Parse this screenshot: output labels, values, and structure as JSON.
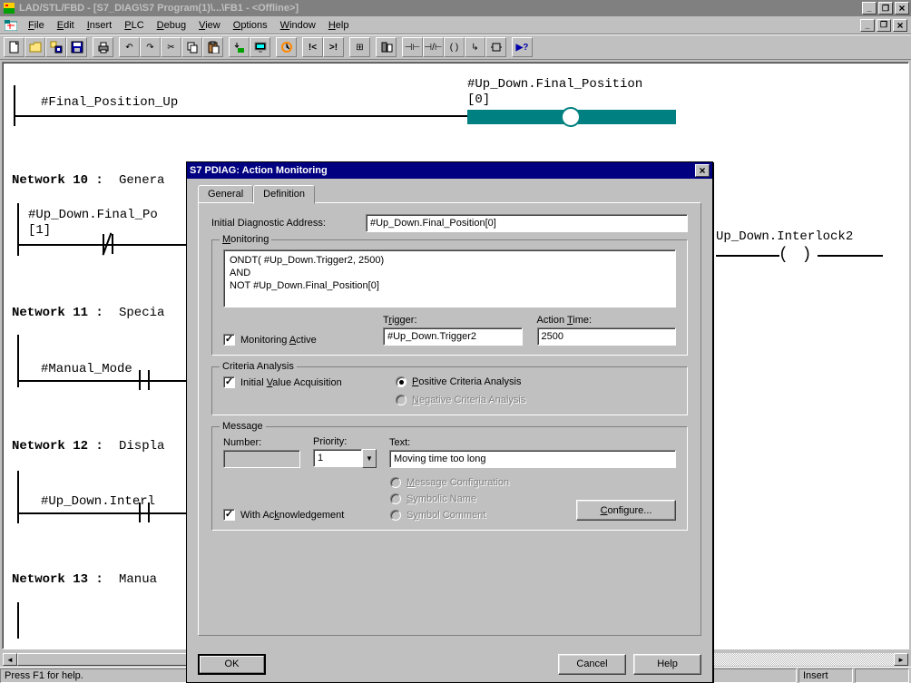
{
  "title": "LAD/STL/FBD  - [S7_DIAG\\S7 Program(1)\\...\\FB1 - <Offline>]",
  "menu": [
    "File",
    "Edit",
    "Insert",
    "PLC",
    "Debug",
    "View",
    "Options",
    "Window",
    "Help"
  ],
  "toolbar_icons": [
    "new",
    "open",
    "save-multi",
    "save",
    "",
    "print",
    "",
    "undo",
    "redo",
    "cut",
    "copy",
    "paste",
    "",
    "download",
    "monitor",
    "",
    "var-table",
    "",
    "goto-start",
    "goto-end",
    "",
    "sym-info",
    "",
    "library",
    "",
    "block1",
    "block2",
    "parens",
    "arrow",
    "ll-icon",
    "",
    "context-help"
  ],
  "editor": {
    "label1": "#Final_Position_Up",
    "label2_line1": "#Up_Down.Final_Position",
    "label2_line2": "[0]",
    "network10": "Network 10 :",
    "network10_title": "Genera",
    "net10_label": "#Up_Down.Final_Po",
    "net10_label2": "[1]",
    "net10_right": "Up_Down.Interlock2",
    "network11": "Network 11 :",
    "network11_title": "Specia",
    "net11_label": "#Manual_Mode",
    "network12": "Network 12 :",
    "network12_title": "Displa",
    "net12_label": "#Up_Down.Interl",
    "network13": "Network 13 :",
    "network13_title": "Manua"
  },
  "dialog": {
    "title": "S7 PDIAG: Action Monitoring",
    "tabs": [
      "General",
      "Definition"
    ],
    "active_tab": 1,
    "init_diag_label": "Initial Diagnostic Address:",
    "init_diag_value": "#Up_Down.Final_Position[0]",
    "monitoring": {
      "legend": "Monitoring",
      "text_l1": "ONDT( #Up_Down.Trigger2, 2500)",
      "text_l2": "AND",
      "text_l3": "NOT #Up_Down.Final_Position[0]",
      "active_label": "Monitoring Active",
      "active_checked": true,
      "trigger_label": "Trigger:",
      "trigger_value": "#Up_Down.Trigger2",
      "action_time_label": "Action Time:",
      "action_time_value": "2500"
    },
    "criteria": {
      "legend": "Criteria Analysis",
      "initial_label": "Initial Value Acquisition",
      "initial_checked": true,
      "positive_label": "Positive Criteria Analysis",
      "negative_label": "Negative Criteria Analysis",
      "selected": "positive"
    },
    "message": {
      "legend": "Message",
      "number_label": "Number:",
      "number_value": "",
      "priority_label": "Priority:",
      "priority_value": "1",
      "text_label": "Text:",
      "text_value": "Moving time too long",
      "msgconfig_label": "Message Configuration",
      "symname_label": "Symbolic Name",
      "symcomment_label": "Symbol Comment",
      "ack_label": "With Acknowledgement",
      "ack_checked": true,
      "configure_btn": "Configure..."
    },
    "buttons": {
      "ok": "OK",
      "cancel": "Cancel",
      "help": "Help"
    }
  },
  "status": {
    "hint": "Press F1 for help.",
    "insert": "Insert"
  }
}
